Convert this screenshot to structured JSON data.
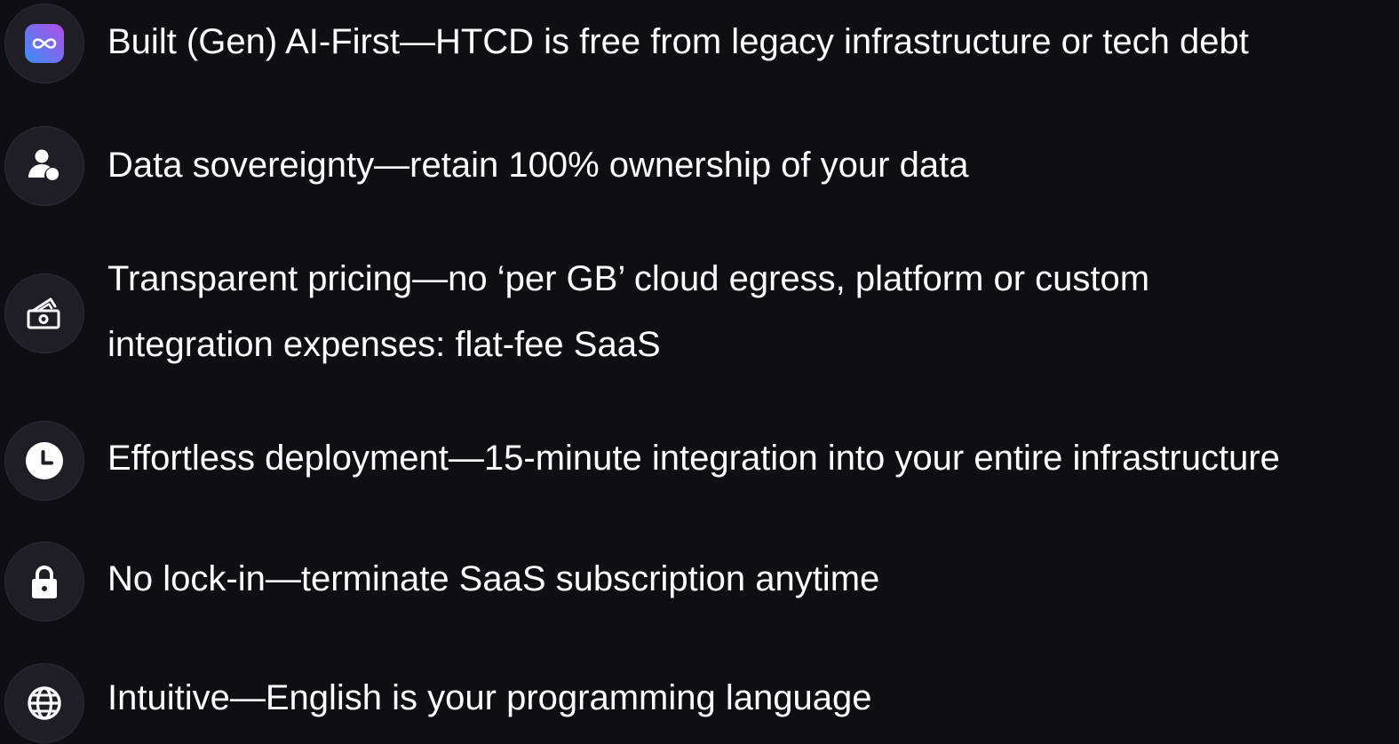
{
  "features": [
    {
      "icon": "infinity-loop-app-icon",
      "text": "Built (Gen) AI-First—HTCD is free from legacy infrastructure or tech debt"
    },
    {
      "icon": "user-data-icon",
      "text": "Data sovereignty—retain 100% ownership of your data"
    },
    {
      "icon": "money-wallet-icon",
      "line1": "Transparent pricing—no ‘per GB’ cloud egress, platform or custom",
      "line2": "integration expenses: flat-fee SaaS"
    },
    {
      "icon": "clock-icon",
      "text": "Effortless deployment—15-minute integration into your entire infrastructure"
    },
    {
      "icon": "lock-icon",
      "text": "No lock-in—terminate SaaS subscription anytime"
    },
    {
      "icon": "globe-icon",
      "text": "Intuitive—English is your programming language"
    }
  ],
  "colors": {
    "background": "#0f0e13",
    "icon_circle": "#1f1e24",
    "text": "#ffffff",
    "app_icon_gradient_start": "#3a8ff5",
    "app_icon_gradient_end": "#b24de8"
  }
}
